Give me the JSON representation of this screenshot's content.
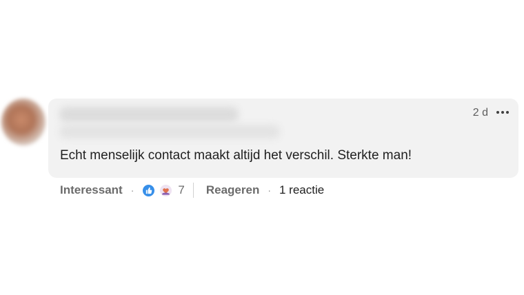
{
  "comment": {
    "timestamp": "2 d",
    "text": "Echt menselijk contact maakt altijd het verschil. Sterkte man!"
  },
  "actions": {
    "react_label": "Interessant",
    "separator": "·",
    "reaction_count": "7",
    "reply_label": "Reageren",
    "replies": "1 reactie"
  },
  "icons": {
    "more": "more-options-icon",
    "like": "like-reaction-icon",
    "love": "love-reaction-icon"
  },
  "colors": {
    "bubble_bg": "#f2f2f2",
    "like_blue": "#378fe9",
    "muted_text": "#6b6b6b",
    "body_text": "#1f1f1f"
  }
}
